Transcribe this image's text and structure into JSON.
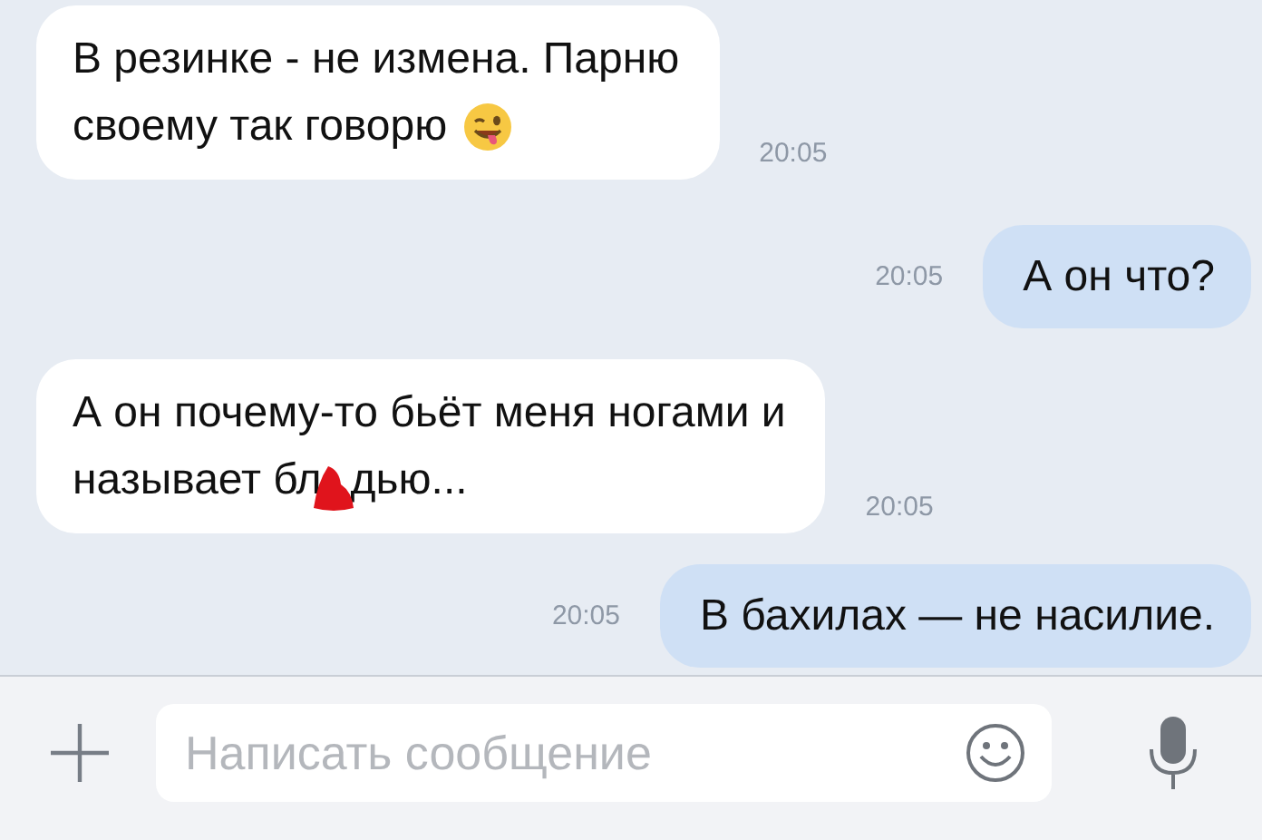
{
  "messages": [
    {
      "kind": "incoming",
      "lines": [
        "В резинке - не измена. Парню",
        "своему так говорю"
      ],
      "emoji": true,
      "time": "20:05"
    },
    {
      "kind": "outgoing",
      "lines": [
        "А он что?"
      ],
      "time": "20:05"
    },
    {
      "kind": "incoming",
      "lines": [
        "А он почему-то бьёт меня ногами и",
        "называет бл"
      ],
      "censored": true,
      "text_after_censor": "дью...",
      "time": "20:05"
    },
    {
      "kind": "outgoing",
      "lines": [
        "В бахилах — не насилие."
      ],
      "time": "20:05"
    }
  ],
  "composer": {
    "placeholder": "Написать сообщение"
  }
}
